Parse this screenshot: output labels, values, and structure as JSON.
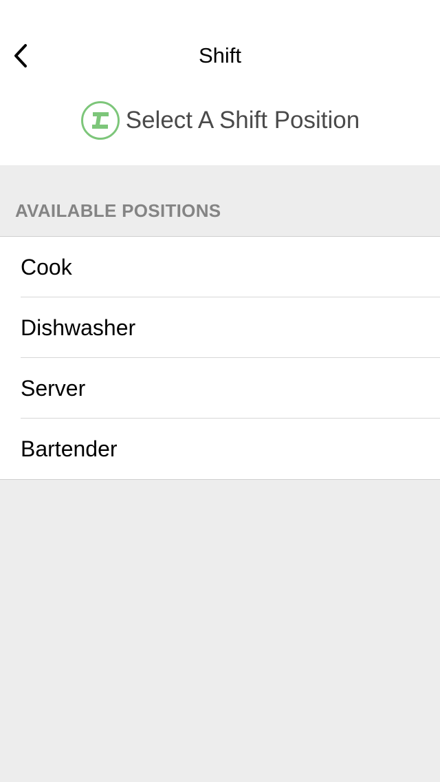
{
  "nav": {
    "title": "Shift",
    "back_icon": "chevron-left-icon"
  },
  "subheader": {
    "logo_icon": "app-logo-icon",
    "text": "Select A Shift Position"
  },
  "section": {
    "label": "AVAILABLE POSITIONS"
  },
  "positions": [
    {
      "label": "Cook"
    },
    {
      "label": "Dishwasher"
    },
    {
      "label": "Server"
    },
    {
      "label": "Bartender"
    }
  ],
  "colors": {
    "brand_green": "#7dc67a",
    "background": "#ededed",
    "section_label": "#848484",
    "subheader_text": "#4a4a4a"
  }
}
